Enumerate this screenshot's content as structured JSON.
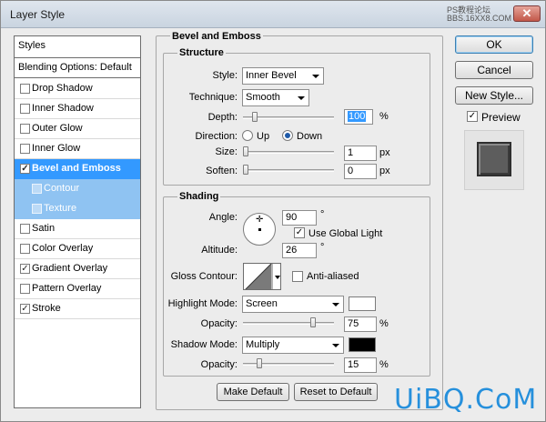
{
  "window": {
    "title": "Layer Style",
    "close_label": "✕"
  },
  "watermark": {
    "top_line1": "PS教程论坛",
    "top_line2": "BBS.16XX8.COM",
    "bottom": "UiBQ.CoM"
  },
  "styles_list": {
    "header": "Styles",
    "blending": "Blending Options: Default",
    "items": [
      {
        "label": "Drop Shadow",
        "checked": false
      },
      {
        "label": "Inner Shadow",
        "checked": false
      },
      {
        "label": "Outer Glow",
        "checked": false
      },
      {
        "label": "Inner Glow",
        "checked": false
      },
      {
        "label": "Bevel and Emboss",
        "checked": true,
        "selected": true
      },
      {
        "label": "Contour",
        "checked": false,
        "sub": true
      },
      {
        "label": "Texture",
        "checked": false,
        "sub": true
      },
      {
        "label": "Satin",
        "checked": false
      },
      {
        "label": "Color Overlay",
        "checked": false
      },
      {
        "label": "Gradient Overlay",
        "checked": true
      },
      {
        "label": "Pattern Overlay",
        "checked": false
      },
      {
        "label": "Stroke",
        "checked": true
      }
    ]
  },
  "buttons": {
    "ok": "OK",
    "cancel": "Cancel",
    "new_style": "New Style...",
    "preview": "Preview"
  },
  "bevel": {
    "title": "Bevel and Emboss",
    "structure": {
      "title": "Structure",
      "style_label": "Style:",
      "style_value": "Inner Bevel",
      "technique_label": "Technique:",
      "technique_value": "Smooth",
      "depth_label": "Depth:",
      "depth_value": "100",
      "depth_unit": "%",
      "direction_label": "Direction:",
      "up": "Up",
      "down": "Down",
      "size_label": "Size:",
      "size_value": "1",
      "size_unit": "px",
      "soften_label": "Soften:",
      "soften_value": "0",
      "soften_unit": "px"
    },
    "shading": {
      "title": "Shading",
      "angle_label": "Angle:",
      "angle_value": "90",
      "angle_unit": "°",
      "global_light": "Use Global Light",
      "altitude_label": "Altitude:",
      "altitude_value": "26",
      "altitude_unit": "°",
      "gloss_label": "Gloss Contour:",
      "anti_aliased": "Anti-aliased",
      "highlight_label": "Highlight Mode:",
      "highlight_mode": "Screen",
      "highlight_color": "#ffffff",
      "hl_opacity_label": "Opacity:",
      "hl_opacity_value": "75",
      "hl_opacity_unit": "%",
      "shadow_label": "Shadow Mode:",
      "shadow_mode": "Multiply",
      "shadow_color": "#000000",
      "sh_opacity_label": "Opacity:",
      "sh_opacity_value": "15",
      "sh_opacity_unit": "%"
    },
    "make_default": "Make Default",
    "reset_default": "Reset to Default"
  }
}
